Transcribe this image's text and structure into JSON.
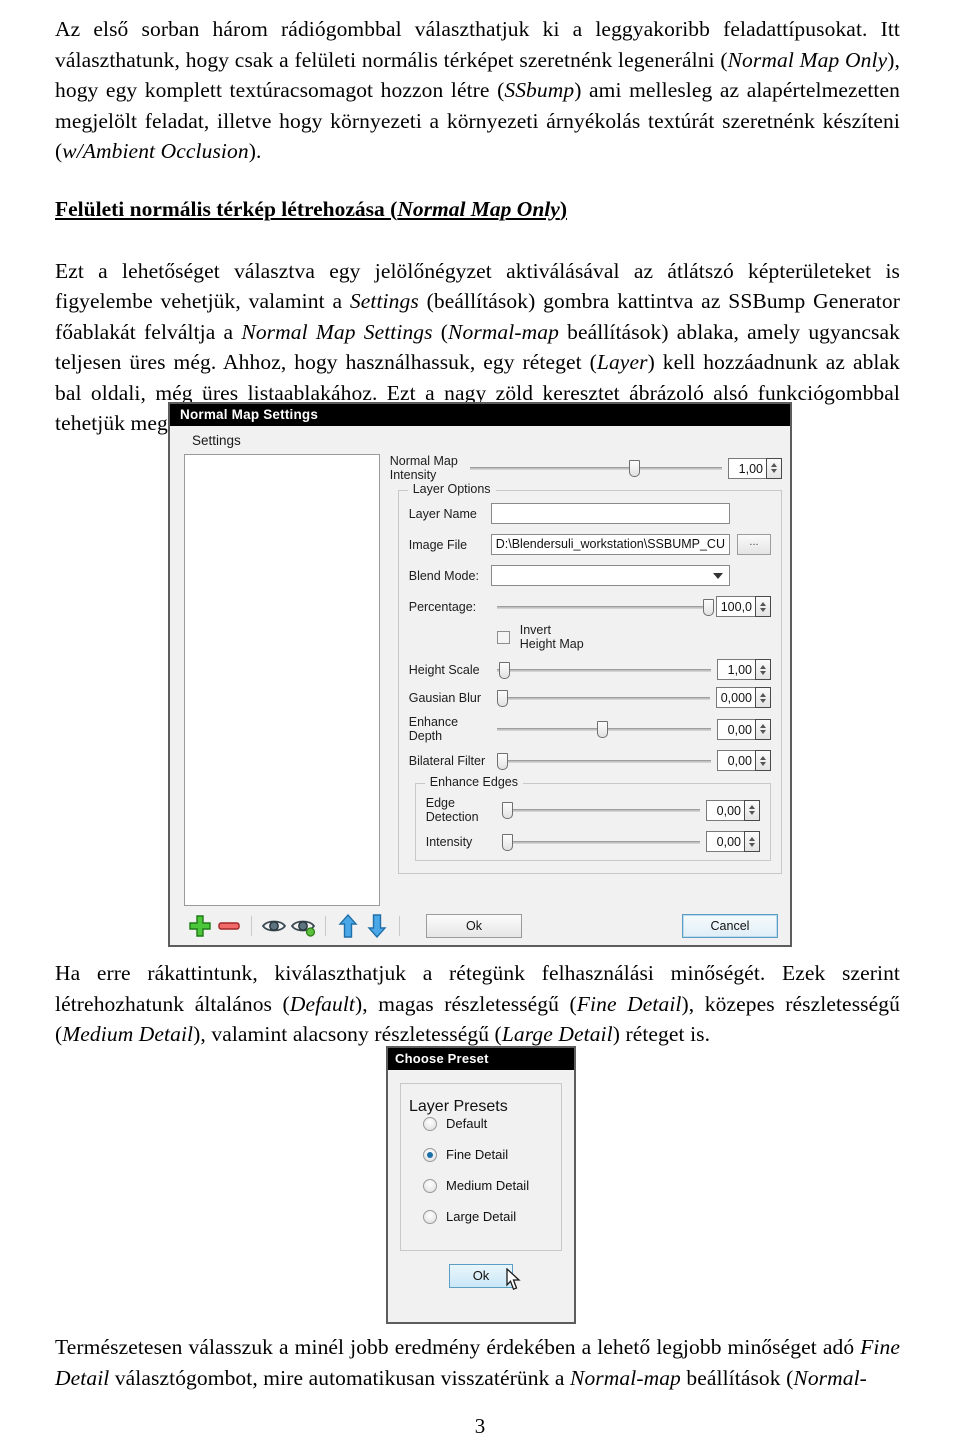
{
  "document": {
    "paragraph1": "Az első sorban három rádiógombbal választhatjuk ki a leggyakoribb feladattípusokat. Itt választhatunk, hogy csak a felületi normális térképet szeretnénk legenerálni (",
    "paragraph1_it1": "Normal Map Only",
    "paragraph1_b": "), hogy egy komplett textúracsomagot hozzon létre (",
    "paragraph1_it2": "SSbump",
    "paragraph1_c": ") ami mellesleg az alapértelmezetten megjelölt feladat, illetve hogy környezeti a környezeti árnyékolás textúrát szeretnénk készíteni (",
    "paragraph1_it3": "w/Ambient Occlusion",
    "paragraph1_d": ").",
    "heading": "Felületi normális térkép létrehozása (",
    "heading_it": "Normal Map Only",
    "heading_end": ")",
    "paragraph2_a": "Ezt a lehetőséget választva egy jelölőnégyzet aktiválásával az átlátszó képterületeket is figyelembe vehetjük, valamint a ",
    "paragraph2_it1": "Settings",
    "paragraph2_b": " (beállítások) gombra kattintva az SSBump Generator főablakát felváltja a ",
    "paragraph2_it2": "Normal Map Settings",
    "paragraph2_c": " (",
    "paragraph2_it3": "Normal-map",
    "paragraph2_d": " beállítások) ablaka, amely ugyancsak teljesen üres még. Ahhoz, hogy használhassuk, egy réteget (",
    "paragraph2_it4": "Layer",
    "paragraph2_e": ") kell hozzáadnunk az ablak bal oldali, még üres listaablakához. Ezt a nagy zöld keresztet ábrázoló alsó funkciógombbal tehetjük meg.",
    "paragraph3_a": "Ha erre rákattintunk, kiválaszthatjuk a rétegünk felhasználási minőségét. Ezek szerint létrehozhatunk általános (",
    "paragraph3_it1": "Default",
    "paragraph3_b": "), magas részletességű (",
    "paragraph3_it2": "Fine Detail",
    "paragraph3_c": "), közepes részletességű (",
    "paragraph3_it3": "Medium Detail",
    "paragraph3_d": "), valamint alacsony részletességű (",
    "paragraph3_it4": "Large Detail",
    "paragraph3_e": ") réteget is.",
    "paragraph4_a": "Természetesen válasszuk a minél jobb eredmény érdekében a lehető legjobb minőséget adó ",
    "paragraph4_it1": "Fine Detail",
    "paragraph4_b": " választógombot, mire automatikusan visszatérünk a ",
    "paragraph4_it2": "Normal-map",
    "paragraph4_c": " beállítások (",
    "paragraph4_it3": "Normal-",
    "page_number": "3"
  },
  "normal_map_dialog": {
    "title": "Normal Map Settings",
    "tab_label": "Settings",
    "intensity": {
      "label_line1": "Normal Map",
      "label_line2": "Intensity",
      "value": "1,00",
      "thumb_pct": 63
    },
    "layer_options": {
      "group_title": "Layer Options",
      "layer_name_label": "Layer Name",
      "layer_name_value": "",
      "image_file_label": "Image File",
      "image_file_value": "D:\\Blendersuli_workstation\\SSBUMP_CU",
      "browse_label": "...",
      "blend_mode_label": "Blend Mode:",
      "blend_mode_value": "",
      "percentage_label": "Percentage:",
      "percentage_value": "100,0",
      "percentage_thumb_pct": 97,
      "invert_line1": "Invert",
      "invert_line2": "Height Map",
      "invert_checked": false,
      "height_scale_label": "Height Scale",
      "height_scale_value": "1,00",
      "height_scale_thumb_pct": 1,
      "gausian_blur_label": "Gausian Blur",
      "gausian_blur_value": "0,000",
      "gausian_blur_thumb_pct": 0,
      "enhance_depth_line1": "Enhance",
      "enhance_depth_line2": "Depth",
      "enhance_depth_value": "0,00",
      "enhance_depth_thumb_pct": 47,
      "bilateral_filter_label": "Bilateral Filter",
      "bilateral_filter_value": "0,00",
      "bilateral_filter_thumb_pct": 0
    },
    "enhance_edges": {
      "group_title": "Enhance Edges",
      "edge_detection_line1": "Edge",
      "edge_detection_line2": "Detection",
      "edge_detection_value": "0,00",
      "edge_detection_thumb_pct": 0,
      "intensity_label": "Intensity",
      "intensity_value": "0,00",
      "intensity_thumb_pct": 0
    },
    "toolbar": {
      "add_icon": "green-plus-icon",
      "remove_icon": "red-minus-icon",
      "show_icon": "eye-icon",
      "show_settings_icon": "eye-settings-icon",
      "move_up_icon": "blue-arrow-up-icon",
      "move_down_icon": "blue-arrow-down-icon"
    },
    "ok_label": "Ok",
    "cancel_label": "Cancel"
  },
  "choose_preset_dialog": {
    "title": "Choose Preset",
    "group_title": "Layer Presets",
    "options": [
      {
        "label": "Default",
        "selected": false
      },
      {
        "label": "Fine Detail",
        "selected": true
      },
      {
        "label": "Medium Detail",
        "selected": false
      },
      {
        "label": "Large Detail",
        "selected": false
      }
    ],
    "ok_label": "Ok",
    "cursor_icon": "mouse-pointer-icon"
  },
  "colors": {
    "title_bar": "#000000",
    "dialog_face": "#f1f1f1",
    "accent_focus": "#5d9ec4",
    "radio_dot": "#1b6ea8",
    "add_icon": "#3fae2a",
    "remove_icon": "#e05b5b",
    "arrow_icon": "#3f9fe0"
  }
}
